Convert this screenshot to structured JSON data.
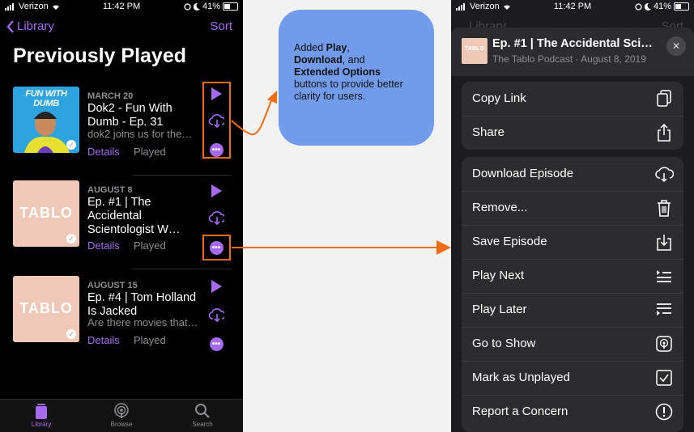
{
  "left_phone": {
    "status": {
      "carrier": "Verizon",
      "time": "11:42 PM",
      "battery": "41%"
    },
    "nav": {
      "back_label": "Library",
      "sort_label": "Sort"
    },
    "title": "Previously Played",
    "episodes": [
      {
        "date": "MARCH 20",
        "title": "Dok2 - Fun With Dumb - Ep. 31",
        "description": "dok2 joins us for the…",
        "details": "Details",
        "played": "Played",
        "art_text": "FUN WITH DUMB"
      },
      {
        "date": "AUGUST 8",
        "title": "Ep. #1 | The Accidental Scientologist W…",
        "description": "",
        "details": "Details",
        "played": "Played",
        "art_text": "TABLO"
      },
      {
        "date": "AUGUST 15",
        "title": "Ep. #4 | Tom Holland Is Jacked",
        "description": "Are there movies that…",
        "details": "Details",
        "played": "Played",
        "art_text": "TABLO"
      }
    ],
    "tabs": [
      {
        "label": "Library",
        "icon": "library-icon",
        "active": true
      },
      {
        "label": "Browse",
        "icon": "podcast-icon",
        "active": false
      },
      {
        "label": "Search",
        "icon": "search-icon",
        "active": false
      }
    ]
  },
  "callout": {
    "line_prefix": "Added ",
    "play": "Play",
    "comma": ",",
    "download": "Download",
    "and": ", and",
    "extended": "Extended Options",
    "suffix": "buttons to provide better clarity for users."
  },
  "right_phone": {
    "status": {
      "carrier": "Verizon",
      "time": "11:42 PM",
      "battery": "41%"
    },
    "ghost_nav": {
      "back_label": "Library",
      "sort_label": "Sort"
    },
    "sheet": {
      "title": "Ep. #1 | The Accidental Scient…",
      "subtitle": "The Tablo Podcast · August 8, 2019",
      "art_text": "TABLO"
    },
    "group1": [
      {
        "label": "Copy Link",
        "icon": "copy-icon"
      },
      {
        "label": "Share",
        "icon": "share-icon"
      }
    ],
    "group2": [
      {
        "label": "Download Episode",
        "icon": "cloud-download-icon"
      },
      {
        "label": "Remove...",
        "icon": "trash-icon"
      },
      {
        "label": "Save Episode",
        "icon": "save-tray-icon"
      },
      {
        "label": "Play Next",
        "icon": "play-next-icon"
      },
      {
        "label": "Play Later",
        "icon": "play-later-icon"
      },
      {
        "label": "Go to Show",
        "icon": "podcast-icon"
      },
      {
        "label": "Mark as Unplayed",
        "icon": "checkbox-icon"
      },
      {
        "label": "Report a Concern",
        "icon": "exclamation-icon"
      }
    ]
  },
  "colors": {
    "accent": "#a56af0",
    "highlight": "#f36c16",
    "callout_bg": "#729ceb"
  }
}
